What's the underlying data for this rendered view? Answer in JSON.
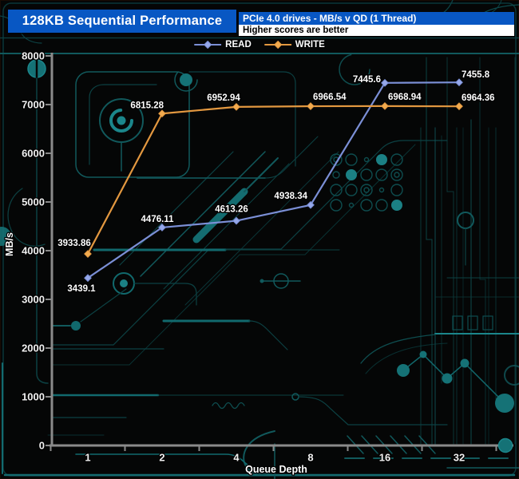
{
  "header": {
    "title": "128KB Sequential Performance",
    "subtitle": "PCIe 4.0 drives - MB/s v QD (1 Thread)",
    "note": "Higher scores are better"
  },
  "colors": {
    "header_blue": "#0857c3",
    "background": "#050606",
    "axis_gray": "#8a8a8a",
    "circuit_teal_dim": "#0c4143",
    "circuit_teal_mid": "#11696d",
    "circuit_teal_bright": "#1b868b",
    "read_line": "#7b8fd6",
    "read_marker": "#96a8ea",
    "write_line": "#e39840",
    "write_marker": "#f2ab4f"
  },
  "chart_data": {
    "type": "line",
    "title": "128KB Sequential Performance",
    "subtitle": "PCIe 4.0 drives - MB/s v QD (1 Thread)",
    "note": "Higher scores are better",
    "xlabel": "Queue Depth",
    "ylabel": "MB/s",
    "categories": [
      "1",
      "2",
      "4",
      "8",
      "16",
      "32"
    ],
    "ylim": [
      0,
      8000
    ],
    "ytick_step": 1000,
    "grid": false,
    "legend_position": "top-center",
    "series": [
      {
        "name": "READ",
        "color": "#7b8fd6",
        "marker_color": "#96a8ea",
        "values": [
          3439.1,
          4476.11,
          4613.26,
          4938.34,
          7445.6,
          7455.8
        ],
        "labels": [
          "3439.1",
          "4476.11",
          "4613.26",
          "4938.34",
          "7445.6",
          "7455.8"
        ]
      },
      {
        "name": "WRITE",
        "color": "#e39840",
        "marker_color": "#f2ab4f",
        "values": [
          3933.86,
          6815.28,
          6952.94,
          6966.54,
          6968.94,
          6964.36
        ],
        "labels": [
          "3933.86",
          "6815.28",
          "6952.94",
          "6966.54",
          "6968.94",
          "6964.36"
        ]
      }
    ]
  }
}
